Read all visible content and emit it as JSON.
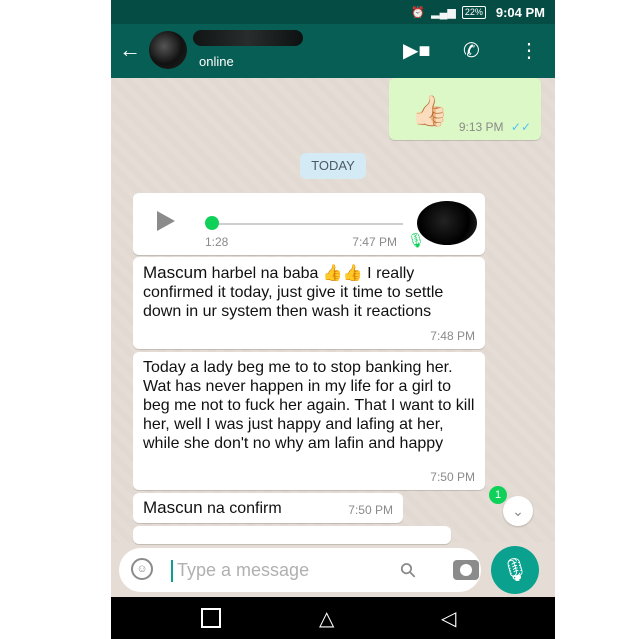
{
  "status_bar": {
    "alarm_icon": "alarm-icon",
    "signal": "signal-icon",
    "battery": "22%",
    "time": "9:04 PM"
  },
  "header": {
    "presence": "online"
  },
  "messages": {
    "sent_thumbs": {
      "emoji": "👍🏻",
      "time": "9:13 PM",
      "ticks": "✓✓"
    },
    "date_chip": "TODAY",
    "voice_note": {
      "duration": "1:28",
      "time": "7:47 PM"
    },
    "msg1": {
      "name": "Mascum",
      "text": " harbel na baba 👍👍 I really confirmed it today,  just give it time to settle down in ur system then wash it reactions",
      "time": "7:48 PM"
    },
    "msg2": {
      "text": "Today a lady beg me to to stop banking her. Wat has never happen in my life for a girl to beg me not to fuck her again. That I want to kill her, well I was just happy and lafing at her, while she don't no why am lafin and happy",
      "time": "7:50 PM"
    },
    "msg3": {
      "name": "Mascun",
      "text": " na confirm",
      "time": "7:50 PM"
    }
  },
  "unread_badge": "1",
  "composer": {
    "placeholder": "Type a message"
  },
  "colors": {
    "header": "#075e54",
    "status_bar": "#054d44",
    "chat_bg": "#e5ddd5",
    "sent_bubble": "#dcf8c6",
    "accent": "#0aa18f",
    "voice_green": "#0fd15a"
  }
}
